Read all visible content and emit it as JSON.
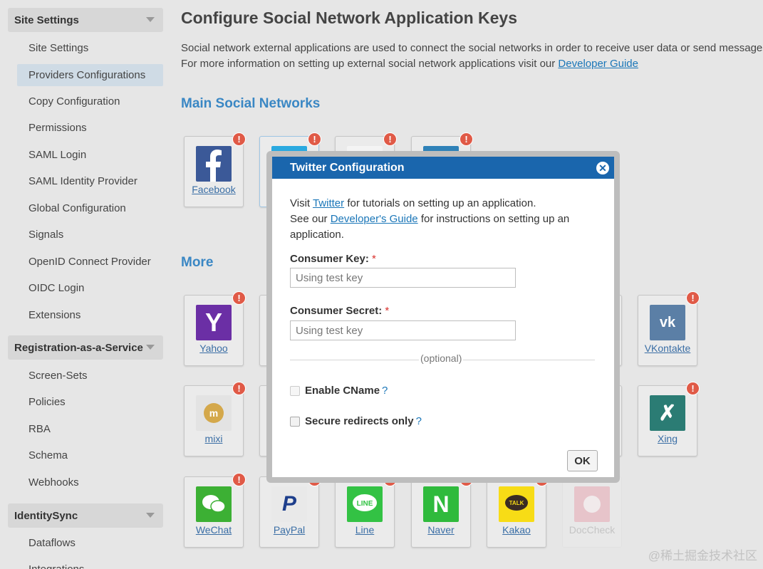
{
  "sidebar": {
    "sections": [
      {
        "title": "Site Settings",
        "items": [
          "Site Settings",
          "Providers Configurations",
          "Copy Configuration",
          "Permissions",
          "SAML Login",
          "SAML Identity Provider",
          "Global Configuration",
          "Signals",
          "OpenID Connect Provider",
          "OIDC Login",
          "Extensions"
        ],
        "active_item": "Providers Configurations"
      },
      {
        "title": "Registration-as-a-Service",
        "items": [
          "Screen-Sets",
          "Policies",
          "RBA",
          "Schema",
          "Webhooks"
        ]
      },
      {
        "title": "IdentitySync",
        "items": [
          "Dataflows",
          "Integrations"
        ]
      }
    ]
  },
  "main": {
    "title": "Configure Social Network Application Keys",
    "intro_line1": "Social network external applications are used to connect the social networks in order to receive user data or send messages",
    "intro_line2_prefix": "For more information on setting up external social network applications visit our ",
    "intro_link": "Developer Guide",
    "main_networks_heading": "Main Social Networks",
    "more_heading": "More",
    "tiles": {
      "facebook": "Facebook",
      "yahoo": "Yahoo",
      "vkontakte": "VKontakte",
      "mixi": "mixi",
      "xing": "Xing",
      "wechat": "WeChat",
      "paypal": "PayPal",
      "line": "Line",
      "naver": "Naver",
      "kakao": "Kakao",
      "doccheck": "DocCheck"
    },
    "alert_glyph": "!"
  },
  "modal": {
    "title": "Twitter Configuration",
    "close_glyph": "✕",
    "desc_visit": "Visit ",
    "desc_twitter_link": "Twitter",
    "desc_visit_rest": " for tutorials on setting up an application.",
    "desc_see": "See our ",
    "desc_guide_link": "Developer's Guide",
    "desc_see_rest": " for instructions on setting up an application.",
    "consumer_key_label": "Consumer Key:",
    "consumer_key_placeholder": "Using test key",
    "consumer_secret_label": "Consumer Secret:",
    "consumer_secret_placeholder": "Using test key",
    "required_mark": "*",
    "optional_label": "(optional)",
    "enable_cname_label": "Enable CName",
    "secure_redirects_label": "Secure redirects only",
    "help_glyph": "?",
    "ok_label": "OK"
  },
  "watermark": "@稀土掘金技术社区",
  "colors": {
    "accent": "#1a66ad",
    "link": "#1a76b8",
    "alert": "#e05a47",
    "active_nav": "#cfdbe5"
  }
}
